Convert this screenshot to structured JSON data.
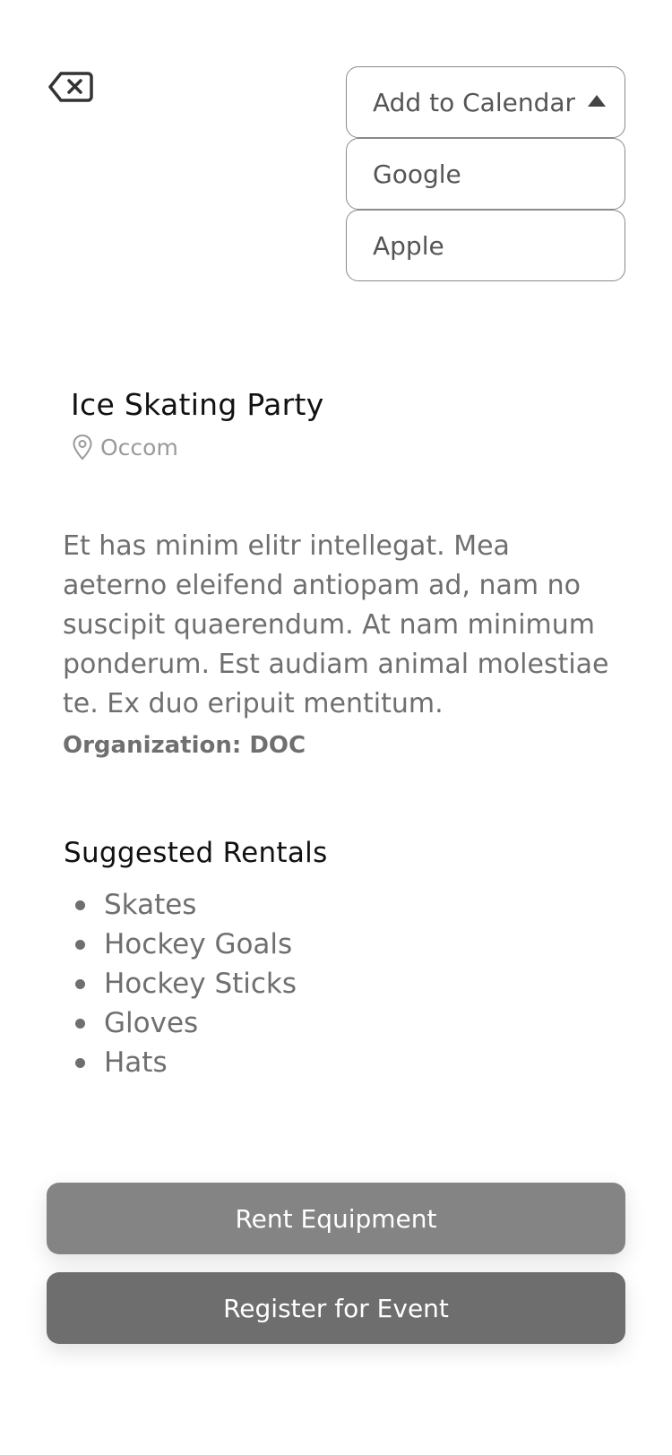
{
  "header": {
    "back_icon": "backspace-x-icon"
  },
  "calendar_menu": {
    "label": "Add to Calendar",
    "options": [
      "Google",
      "Apple"
    ]
  },
  "event": {
    "title": "Ice Skating Party",
    "location": "Occom",
    "location_icon": "map-pin-icon",
    "description": "Et has minim elitr intellegat. Mea aeterno eleifend antiopam ad, nam no suscipit quaerendum. At nam minimum ponderum. Est audiam animal molestiae te. Ex duo eripuit mentitum.",
    "organization": "Organization: DOC"
  },
  "rentals": {
    "title": "Suggested Rentals",
    "items": [
      "Skates",
      "Hockey Goals",
      "Hockey Sticks",
      "Gloves",
      "Hats"
    ]
  },
  "actions": {
    "rent_label": "Rent Equipment",
    "register_label": "Register for Event"
  },
  "colors": {
    "rent_button": "#848484",
    "register_button": "#6e6e6e",
    "body_text": "#6f6f6f"
  }
}
